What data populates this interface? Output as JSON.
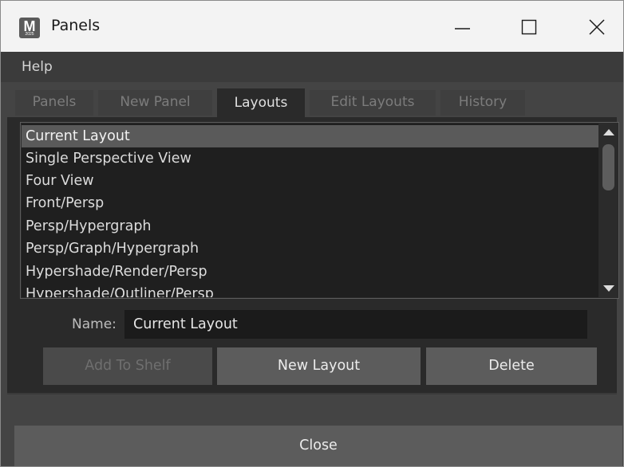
{
  "window": {
    "title": "Panels",
    "app_icon_letter": "M",
    "app_icon_sub": "2025"
  },
  "menubar": {
    "items": [
      "Help"
    ]
  },
  "tabs": [
    {
      "label": "Panels",
      "active": false
    },
    {
      "label": "New Panel",
      "active": false
    },
    {
      "label": "Layouts",
      "active": true
    },
    {
      "label": "Edit Layouts",
      "active": false
    },
    {
      "label": "History",
      "active": false
    }
  ],
  "layouts_list": {
    "items": [
      "Current Layout",
      "Single Perspective View",
      "Four View",
      "Front/Persp",
      "Persp/Hypergraph",
      "Persp/Graph/Hypergraph",
      "Hypershade/Render/Persp",
      "Hypershade/Outliner/Persp"
    ],
    "selected_index": 0
  },
  "name_field": {
    "label": "Name:",
    "value": "Current Layout"
  },
  "buttons": {
    "add_to_shelf": "Add To Shelf",
    "new_layout": "New Layout",
    "delete": "Delete",
    "close": "Close"
  },
  "colors": {
    "window_bg": "#444444",
    "panel_bg": "#2a2a2a",
    "list_bg": "#1f1f1f",
    "selected_row": "#5a5a5a",
    "button_bg": "#5c5c5c",
    "titlebar_bg": "#f3f3f3"
  }
}
